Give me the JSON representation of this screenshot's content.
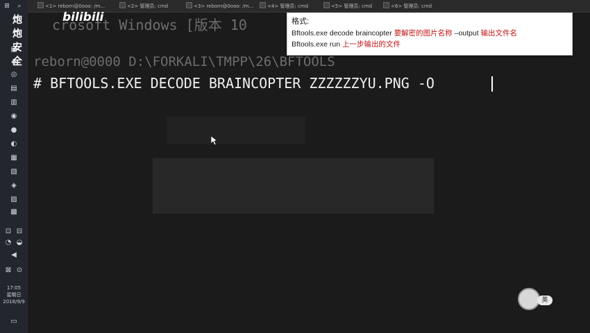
{
  "tabs": [
    "<1> reborn@0ooo: /m...",
    "<2> 管理员: cmd",
    "<3> reborn@0ooo: /m...",
    "<4> 管理员: cmd",
    "<5> 管理员: cmd",
    "<6> 管理员: cmd"
  ],
  "watermark": {
    "channel": "炮炮安全",
    "logo": "bilibili"
  },
  "terminal": {
    "line1": "crosoft Windows [版本 10",
    "line2": "reborn@0000 D:\\FORKALI\\TMPP\\26\\BFTOOLS",
    "line3": "# BFTOOLS.EXE DECODE BRAINCOPTER ZZZZZZYU.PNG -O"
  },
  "tooltip": {
    "title": "格式:",
    "l1_cmd": "Bftools.exe decode braincopter ",
    "l1_note1": "要解密的图片名称",
    "l1_opt": " –output ",
    "l1_note2": "输出文件名",
    "l2_cmd": "Bftools.exe run ",
    "l2_note": "上一步输出的文件"
  },
  "clock": {
    "time": "17:05",
    "weekday": "星期日",
    "date": "2018/9/9"
  },
  "ime": {
    "label": "英"
  },
  "colors": {
    "terminal_bg": "#1b1b1b",
    "accent_red": "#c21414"
  }
}
